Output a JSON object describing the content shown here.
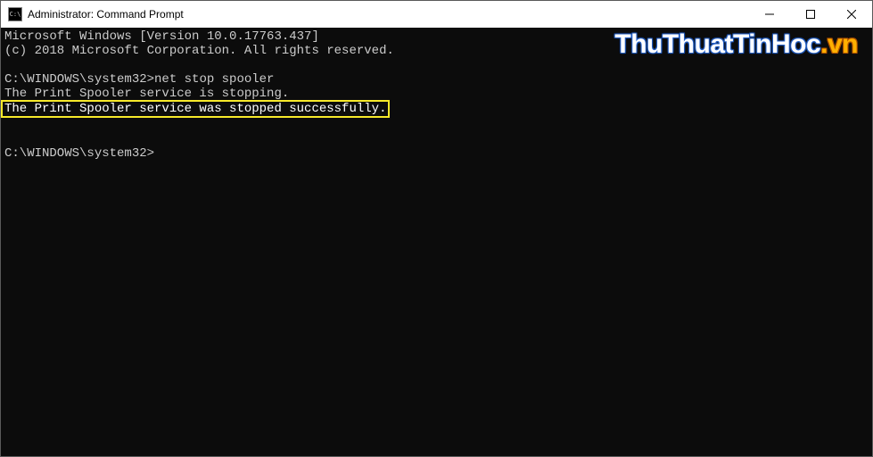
{
  "titlebar": {
    "icon_name": "cmd-icon",
    "icon_text": "C:\\",
    "title": "Administrator: Command Prompt",
    "minimize_label": "Minimize",
    "maximize_label": "Maximize",
    "close_label": "Close"
  },
  "terminal": {
    "banner_line1": "Microsoft Windows [Version 10.0.17763.437]",
    "banner_line2": "(c) 2018 Microsoft Corporation. All rights reserved.",
    "blank": "",
    "prompt1_path": "C:\\WINDOWS\\system32>",
    "prompt1_cmd": "net stop spooler",
    "output_line1": "The Print Spooler service is stopping.",
    "output_line2_highlight": "The Print Spooler service was stopped successfully.",
    "prompt2_path": "C:\\WINDOWS\\system32>"
  },
  "watermark": {
    "part1": "ThuThuatTinHoc",
    "part2": ".vn"
  }
}
